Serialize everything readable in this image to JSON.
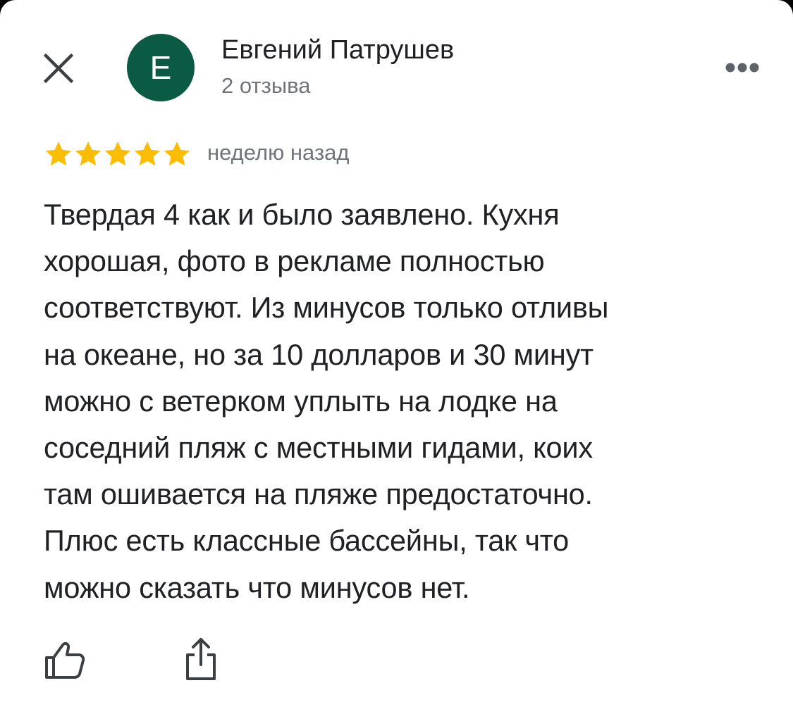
{
  "header": {
    "close_icon": "close-icon",
    "avatar_letter": "Е",
    "avatar_color": "#0b5a44",
    "author_name": "Евгений Патрушев",
    "review_count": "2 отзыва",
    "more_icon": "more-horizontal-icon"
  },
  "review": {
    "rating": 5,
    "rating_max": 5,
    "star_color": "#fbbc04",
    "time_ago": "неделю назад",
    "lines": [
      "Твердая 4 как и было заявлено. Кухня",
      "хорошая, фото в рекламе полностью",
      "соответствуют. Из минусов только отливы",
      "на океане, но за 10 долларов и 30 минут",
      "можно с ветерком уплыть на лодке на",
      "соседний пляж с местными гидами, коих",
      "там ошивается на пляже предостаточно.",
      "Плюс есть классные бассейны, так что",
      "можно сказать что минусов нет."
    ]
  },
  "actions": {
    "like_icon": "thumbs-up-icon",
    "share_icon": "share-icon"
  }
}
